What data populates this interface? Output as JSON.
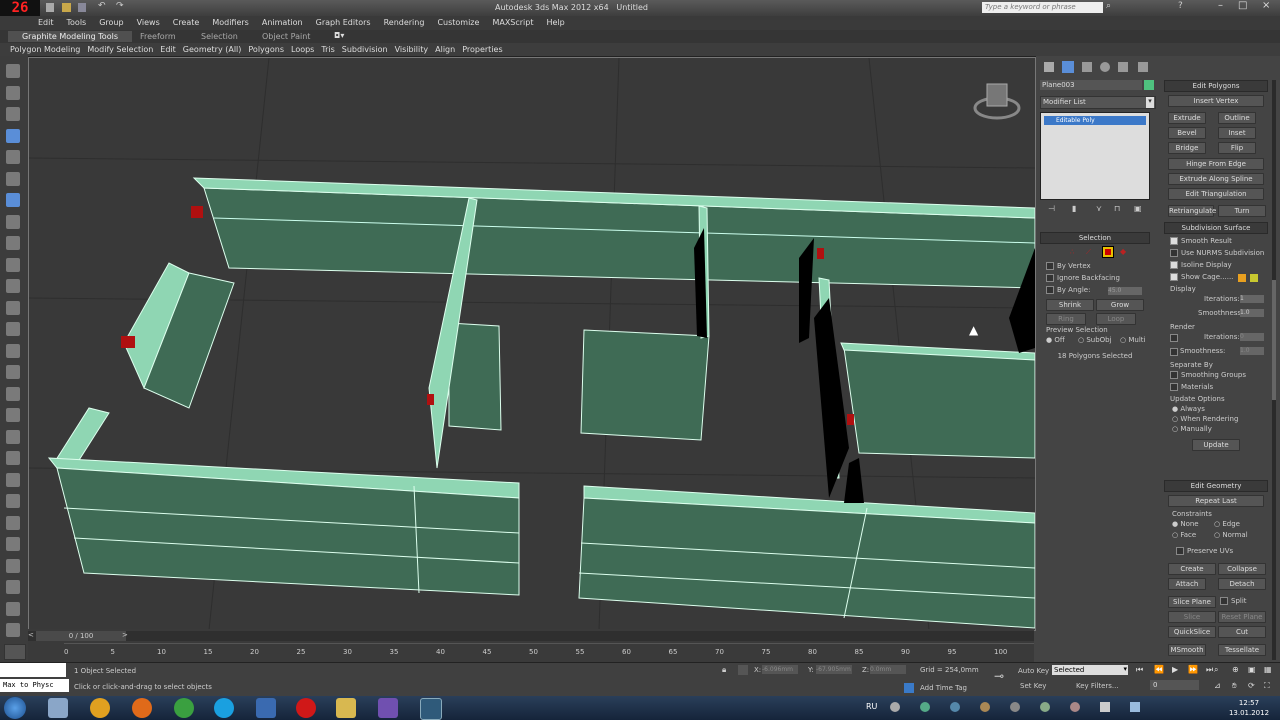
{
  "app": {
    "title": "Autodesk 3ds Max 2012 x64",
    "doc": "Untitled",
    "frame_counter": "26",
    "search_placeholder": "Type a keyword or phrase"
  },
  "menu": [
    "Edit",
    "Tools",
    "Group",
    "Views",
    "Create",
    "Modifiers",
    "Animation",
    "Graph Editors",
    "Rendering",
    "Customize",
    "MAXScript",
    "Help"
  ],
  "ribbon_tabs": [
    "Graphite Modeling Tools",
    "Freeform",
    "Selection",
    "Object Paint"
  ],
  "ribbon_items": [
    "Polygon Modeling",
    "Modify Selection",
    "Edit",
    "Geometry (All)",
    "Polygons",
    "Loops",
    "Tris",
    "Subdivision",
    "Visibility",
    "Align",
    "Properties"
  ],
  "modify_panel": {
    "object_name": "Plane003",
    "modifier_list": "Modifier List",
    "stack_item": "Editable Poly",
    "selection": {
      "header": "Selection",
      "by_vertex": "By Vertex",
      "ignore_backfacing": "Ignore Backfacing",
      "by_angle": "By Angle:",
      "angle_value": "45.0",
      "shrink": "Shrink",
      "grow": "Grow",
      "ring": "Ring",
      "loop": "Loop",
      "preview_selection": "Preview Selection",
      "off": "Off",
      "subobj": "SubObj",
      "multi": "Multi",
      "status": "18 Polygons Selected"
    }
  },
  "edit_polygons": {
    "header": "Edit Polygons",
    "insert_vertex": "Insert Vertex",
    "extrude": "Extrude",
    "outline": "Outline",
    "bevel": "Bevel",
    "inset": "Inset",
    "bridge": "Bridge",
    "flip": "Flip",
    "hinge": "Hinge From Edge",
    "extrude_spline": "Extrude Along Spline",
    "edit_triangulation": "Edit Triangulation",
    "retriangulate": "Retriangulate",
    "turn": "Turn"
  },
  "subdivision": {
    "header": "Subdivision Surface",
    "smooth_result": "Smooth Result",
    "nurms": "Use NURMS Subdivision",
    "isoline": "Isoline Display",
    "show_cage": "Show Cage......",
    "display": "Display",
    "iterations": "Iterations:",
    "iterations_val": "1",
    "smoothness": "Smoothness:",
    "smoothness_val": "1.0",
    "render": "Render",
    "r_iterations_val": "0",
    "r_smoothness_val": "1.0",
    "separate_by": "Separate By",
    "smoothing_groups": "Smoothing Groups",
    "materials": "Materials",
    "update_options": "Update Options",
    "always": "Always",
    "when_rendering": "When Rendering",
    "manually": "Manually",
    "update": "Update"
  },
  "edit_geometry": {
    "header": "Edit Geometry",
    "repeat_last": "Repeat Last",
    "constraints": "Constraints",
    "none": "None",
    "edge": "Edge",
    "face": "Face",
    "normal": "Normal",
    "preserve_uvs": "Preserve UVs",
    "create": "Create",
    "collapse": "Collapse",
    "attach": "Attach",
    "detach": "Detach",
    "slice_plane": "Slice Plane",
    "split": "Split",
    "slice": "Slice",
    "reset_plane": "Reset Plane",
    "quickslice": "QuickSlice",
    "cut": "Cut",
    "msmooth": "MSmooth",
    "tessellate": "Tessellate"
  },
  "timeline": {
    "frame": "0 / 100",
    "ticks": [
      "0",
      "5",
      "10",
      "15",
      "20",
      "25",
      "30",
      "35",
      "40",
      "45",
      "50",
      "55",
      "60",
      "65",
      "70",
      "75",
      "80",
      "85",
      "90",
      "95",
      "100"
    ]
  },
  "status": {
    "selected": "1 Object Selected",
    "prompt": "Click or click-and-drag to select objects",
    "maxscript": "Max to Physc",
    "x": "X:",
    "x_val": "-6.096mm",
    "y": "Y:",
    "y_val": "-67.905mm",
    "z": "Z:",
    "z_val": "0.0mm",
    "grid": "Grid = 254,0mm",
    "add_time_tag": "Add Time Tag",
    "auto_key": "Auto Key",
    "set_key": "Set Key",
    "selected_dropdown": "Selected",
    "key_filters": "Key Filters...",
    "frame_field": "0"
  },
  "taskbar": {
    "lang": "RU",
    "time": "12:57",
    "date": "13.01.2012"
  },
  "colors": {
    "wall": "#3f6b55",
    "wall_top": "#8fd6b3",
    "viewport": "#393939",
    "object_color": "#4fc27f"
  }
}
